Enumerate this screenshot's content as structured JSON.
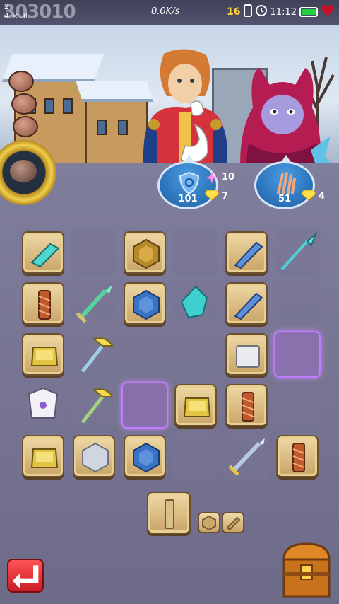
{
  "status_bar": {
    "watermark": "303010",
    "left_top": "2",
    "left_bottom": "4 ⨯ .ıl",
    "speed": "0.0K/s",
    "badge": "16",
    "time": "11:12"
  },
  "characters": {
    "hero": {
      "defense_value": "101",
      "stat_sparkle": "10",
      "stat_gem": "7"
    },
    "enemy": {
      "attack_value": "51",
      "stat_gem": "4"
    }
  },
  "board": {
    "rows": 5,
    "cols": 6,
    "cells": [
      [
        "blade-shard",
        "empty",
        "hex-shield",
        "empty",
        "blue-blade",
        "spear"
      ],
      [
        "wrapped-handle",
        "green-sword",
        "blue-hex-shield",
        "cyan-crystal",
        "blue-blade",
        "empty"
      ],
      [
        "gold-block",
        "golden-pickaxe",
        "empty",
        "empty",
        "silver-block",
        "glow-empty"
      ],
      [
        "ornate-armor",
        "green-pickaxe",
        "glow-empty",
        "gold-block",
        "wrapped-handle",
        "empty"
      ],
      [
        "gold-block",
        "silver-hex-shield",
        "blue-hex-shield",
        "empty",
        "steel-sword",
        "wrapped-handle"
      ]
    ]
  },
  "colors": {
    "accent_blue": "#1d5fa7",
    "glow_purple": "#c27cff",
    "tile_face": "#efd9a6",
    "back_button": "#e0242f"
  },
  "icons": {
    "back": "return-arrow-icon",
    "chest": "treasure-chest-icon",
    "shield": "shield-icon",
    "claw": "claw-icon"
  }
}
